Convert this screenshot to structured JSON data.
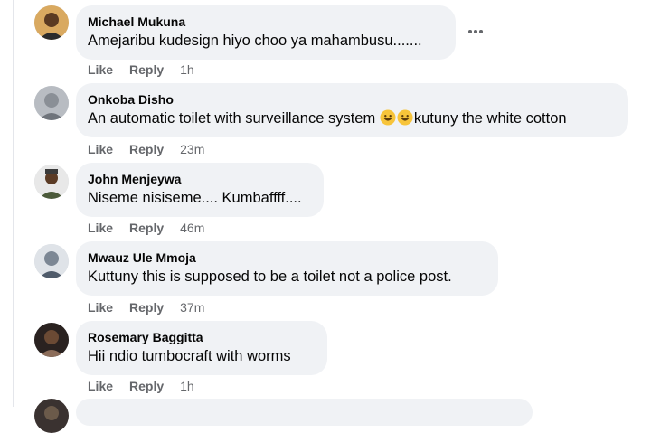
{
  "comments": [
    {
      "author": "Michael Mukuna",
      "text": "Amejaribu kudesign hiyo choo ya mahambusu.......",
      "like_label": "Like",
      "reply_label": "Reply",
      "time": "1h",
      "avatar": "user-avatar-icon"
    },
    {
      "author": "Onkoba Disho",
      "text_before_emoji": "An automatic toilet with surveillance system ",
      "emojis": [
        "grinning-face-emoji",
        "grinning-face-emoji"
      ],
      "text_after_emoji": "kutuny the white cotton",
      "like_label": "Like",
      "reply_label": "Reply",
      "time": "23m",
      "avatar": "user-avatar-icon"
    },
    {
      "author": "John Menjeywa",
      "text": "Niseme nisiseme.... Kumbaffff....",
      "like_label": "Like",
      "reply_label": "Reply",
      "time": "46m",
      "avatar": "user-avatar-icon"
    },
    {
      "author": "Mwauz Ule Mmoja",
      "text": "Kuttuny this is supposed to be a toilet not a police post.",
      "like_label": "Like",
      "reply_label": "Reply",
      "time": "37m",
      "avatar": "user-avatar-icon"
    },
    {
      "author": "Rosemary Baggitta",
      "text": "Hii ndio tumbocraft with worms",
      "like_label": "Like",
      "reply_label": "Reply",
      "time": "1h",
      "avatar": "user-avatar-icon"
    }
  ],
  "more_options_icon": "more-options-icon",
  "colors": {
    "bubble": "#f0f2f5",
    "text": "#050505",
    "secondary": "#65676b",
    "emoji": "#f7c43a"
  }
}
